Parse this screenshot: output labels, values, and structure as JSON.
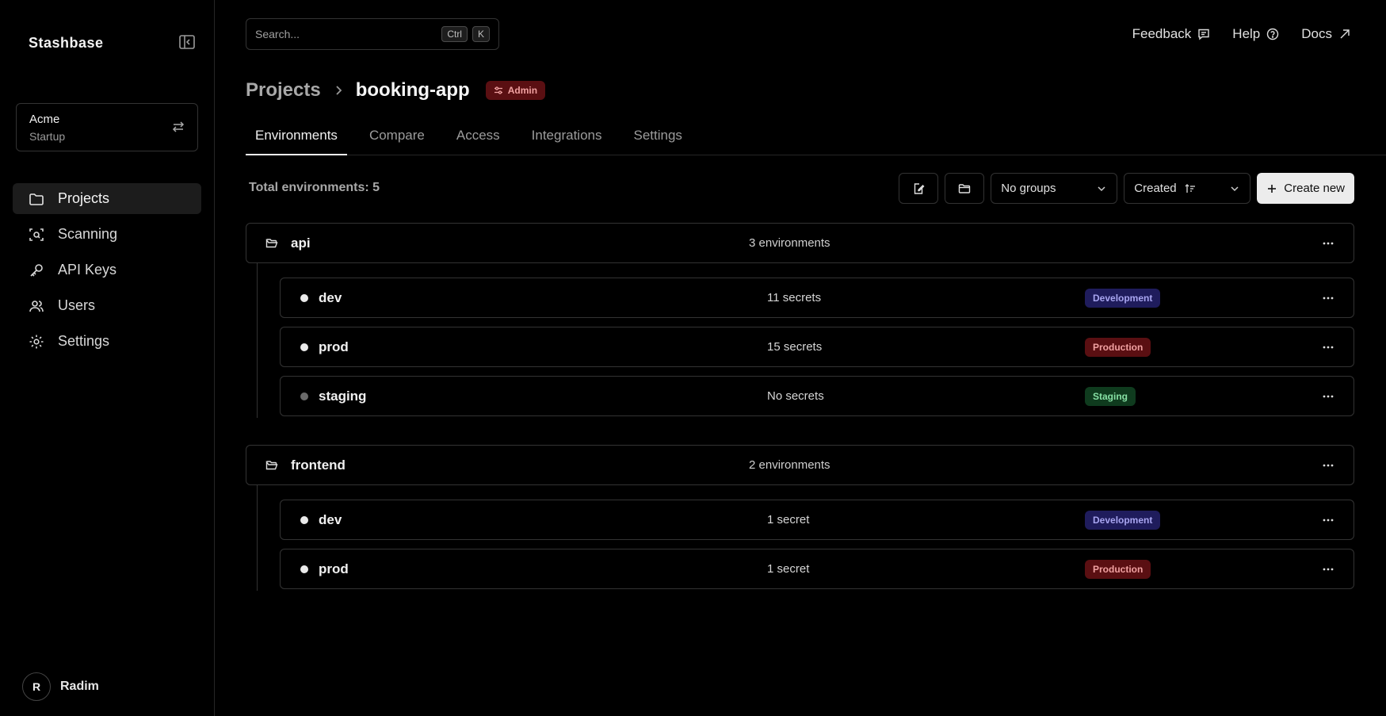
{
  "sidebar": {
    "brand": "Stashbase",
    "org": {
      "name": "Acme",
      "plan": "Startup"
    },
    "items": [
      {
        "label": "Projects",
        "icon": "folder-icon",
        "active": true
      },
      {
        "label": "Scanning",
        "icon": "scan-icon"
      },
      {
        "label": "API Keys",
        "icon": "key-icon"
      },
      {
        "label": "Users",
        "icon": "users-icon"
      },
      {
        "label": "Settings",
        "icon": "gear-icon"
      }
    ],
    "user": {
      "initial": "R",
      "name": "Radim"
    }
  },
  "header": {
    "search_placeholder": "Search...",
    "shortcut": [
      "Ctrl",
      "K"
    ],
    "links": {
      "feedback": "Feedback",
      "help": "Help",
      "docs": "Docs"
    }
  },
  "breadcrumb": {
    "root": "Projects",
    "current": "booking-app",
    "role_badge": "Admin"
  },
  "tabs": [
    "Environments",
    "Compare",
    "Access",
    "Integrations",
    "Settings"
  ],
  "toolbar": {
    "total": "Total environments: 5",
    "group_select": "No groups",
    "sort_select": "Created",
    "create": "Create new"
  },
  "groups": [
    {
      "name": "api",
      "count": "3 environments",
      "envs": [
        {
          "name": "dev",
          "secrets": "11 secrets",
          "type": "Development"
        },
        {
          "name": "prod",
          "secrets": "15 secrets",
          "type": "Production"
        },
        {
          "name": "staging",
          "secrets": "No secrets",
          "type": "Staging"
        }
      ]
    },
    {
      "name": "frontend",
      "count": "2 environments",
      "envs": [
        {
          "name": "dev",
          "secrets": "1 secret",
          "type": "Development"
        },
        {
          "name": "prod",
          "secrets": "1 secret",
          "type": "Production"
        }
      ]
    }
  ],
  "colors": {
    "background": "#000000",
    "development_badge": "#1f1c5c",
    "production_badge": "#5a0f12",
    "staging_badge": "#0f3b1e",
    "primary_button": "#ececec"
  }
}
